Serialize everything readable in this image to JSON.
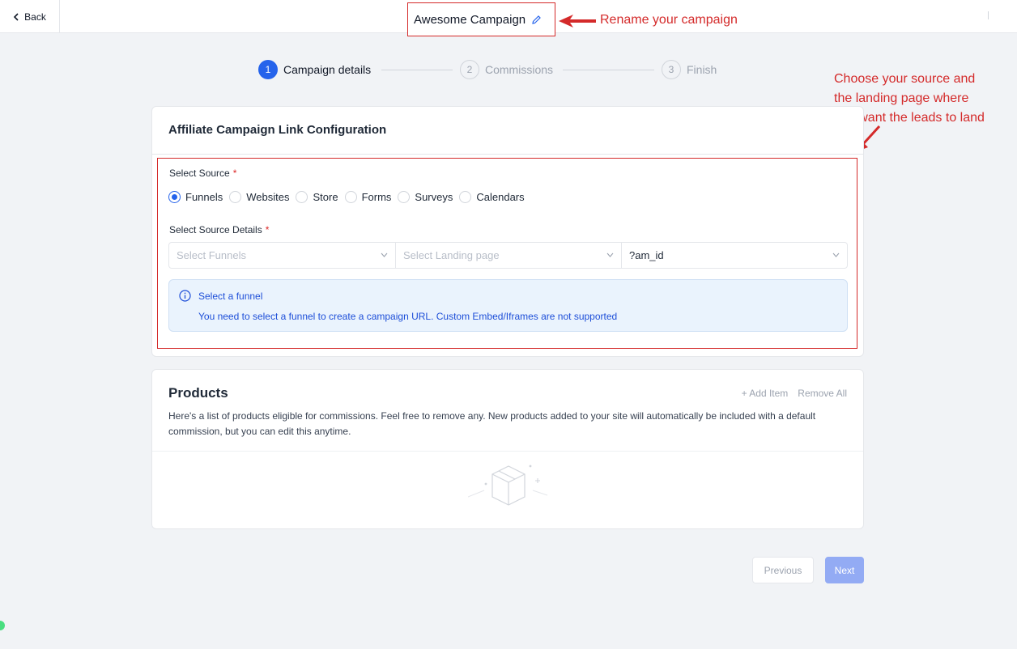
{
  "header": {
    "back_label": "Back",
    "campaign_title": "Awesome Campaign"
  },
  "annotations": {
    "rename": "Rename your campaign",
    "source_line1": "Choose your source and",
    "source_line2": "the landing page where",
    "source_line3": "you want the leads to land",
    "color": "#d42a2a"
  },
  "stepper": {
    "steps": [
      {
        "number": "1",
        "label": "Campaign details",
        "state": "active"
      },
      {
        "number": "2",
        "label": "Commissions",
        "state": "inactive"
      },
      {
        "number": "3",
        "label": "Finish",
        "state": "inactive"
      }
    ]
  },
  "link_config": {
    "title": "Affiliate Campaign Link Configuration",
    "source_label": "Select Source",
    "required_mark": "*",
    "sources": [
      {
        "label": "Funnels",
        "checked": true
      },
      {
        "label": "Websites",
        "checked": false
      },
      {
        "label": "Store",
        "checked": false
      },
      {
        "label": "Forms",
        "checked": false
      },
      {
        "label": "Surveys",
        "checked": false
      },
      {
        "label": "Calendars",
        "checked": false
      }
    ],
    "details_label": "Select Source Details",
    "funnel_placeholder": "Select Funnels",
    "landing_placeholder": "Select Landing page",
    "param_value": "?am_id",
    "info_title": "Select a funnel",
    "info_message": "You need to select a funnel to create a campaign URL. Custom Embed/Iframes are not supported"
  },
  "products": {
    "title": "Products",
    "add_label": "+ Add Item",
    "remove_label": "Remove All",
    "description": "Here's a list of products eligible for commissions. Feel free to remove any. New products added to your site will automatically be included with a default commission, but you can edit this anytime."
  },
  "footer": {
    "previous_label": "Previous",
    "next_label": "Next"
  },
  "colors": {
    "accent": "#2563eb",
    "next_disabled": "#93abf4",
    "info_bg": "#eaf3fd"
  }
}
